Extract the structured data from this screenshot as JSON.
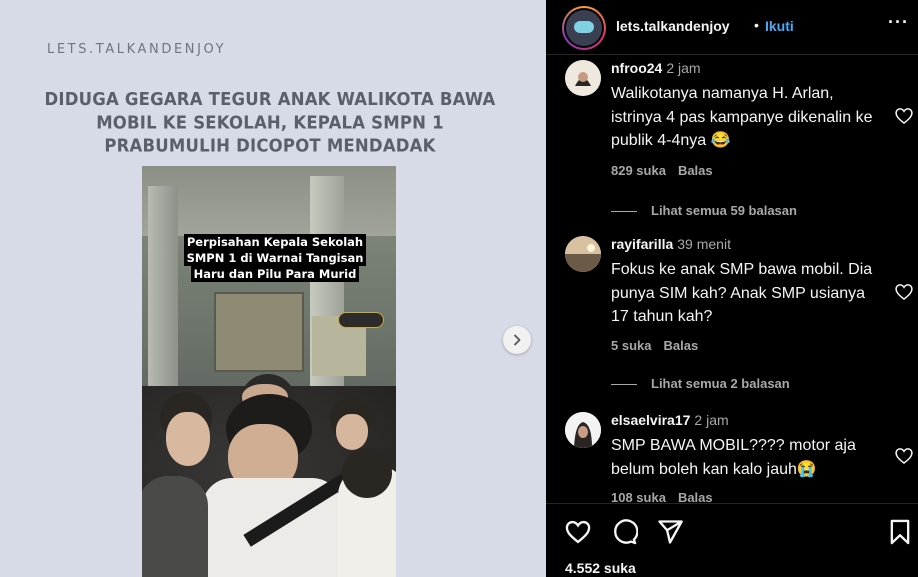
{
  "post": {
    "brand": "LETS.TALKANDENJOY",
    "headline": "DIDUGA GEGARA TEGUR ANAK WALIKOTA BAWA MOBIL KE SEKOLAH, KEPALA SMPN 1 PRABUMULIH DICOPOT MENDADAK",
    "video_caption": "Perpisahan Kepala Sekolah SMPN 1 di Warnai Tangisan Haru dan Pilu Para Murid"
  },
  "header": {
    "username": "lets.talkandenjoy",
    "separator": "•",
    "follow_label": "Ikuti",
    "more_label": "···"
  },
  "comments": [
    {
      "username": "nfroo24",
      "time": "2 jam",
      "text": "Walikotanya namanya H. Arlan, istrinya 4 pas kampanye dikenalin ke publik 4-4nya 😂",
      "likes": "829 suka",
      "reply_label": "Balas",
      "view_replies": "Lihat semua 59 balasan"
    },
    {
      "username": "rayifarilla",
      "time": "39 menit",
      "text": "Fokus ke anak SMP bawa mobil. Dia punya SIM kah? Anak SMP usianya 17 tahun kah?",
      "likes": "5 suka",
      "reply_label": "Balas",
      "view_replies": "Lihat semua 2 balasan"
    },
    {
      "username": "elsaelvira17",
      "time": "2 jam",
      "text": "SMP BAWA MOBIL???? motor aja belum boleh kan kalo jauh😭",
      "likes": "108 suka",
      "reply_label": "Balas"
    }
  ],
  "footer": {
    "like_count": "4.552 suka"
  },
  "icons": {
    "next": "chevron-right-icon",
    "like": "heart-icon",
    "comment": "comment-icon",
    "share": "send-icon",
    "save": "bookmark-icon",
    "more": "more-horizontal-icon"
  },
  "colors": {
    "media_background": "#d7dbe7",
    "follow_link": "#4aa8f8",
    "panel_background": "#000000",
    "secondary_text": "#a8a8a8"
  }
}
